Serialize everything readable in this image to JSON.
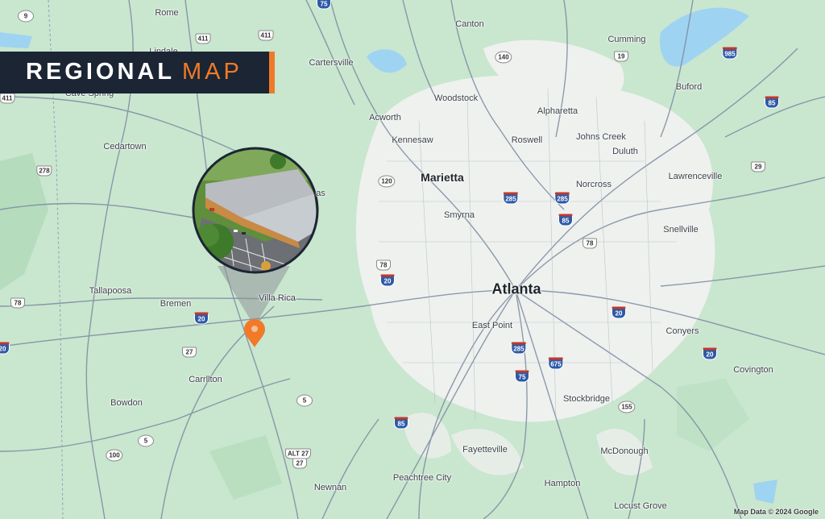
{
  "header": {
    "title_bold": "REGIONAL",
    "title_light": "MAP"
  },
  "colors": {
    "accent": "#f07a28",
    "banner_bg": "#1b2533",
    "land": "#c9e6cf",
    "urban": "#eef1ee",
    "water": "#9fd3f2",
    "road": "#7d8aa0"
  },
  "icons": {
    "marker": "map-pin-icon",
    "photo": "property-aerial-photo"
  },
  "attribution": "Map Data © 2024 Google",
  "cities": [
    {
      "id": "rome",
      "name": "Rome",
      "cls": ""
    },
    {
      "id": "lindale",
      "name": "Lindale",
      "cls": ""
    },
    {
      "id": "cave-spring",
      "name": "Cave Spring",
      "cls": ""
    },
    {
      "id": "cedartown",
      "name": "Cedartown",
      "cls": ""
    },
    {
      "id": "tallapoosa",
      "name": "Tallapoosa",
      "cls": ""
    },
    {
      "id": "bremen",
      "name": "Bremen",
      "cls": ""
    },
    {
      "id": "villa-rica",
      "name": "Villa Rica",
      "cls": ""
    },
    {
      "id": "carrollton",
      "name": "Carrllton",
      "cls": ""
    },
    {
      "id": "bowdon",
      "name": "Bowdon",
      "cls": ""
    },
    {
      "id": "newnan",
      "name": "Newnan",
      "cls": ""
    },
    {
      "id": "peachtree-city",
      "name": "Peachtree City",
      "cls": ""
    },
    {
      "id": "fayetteville",
      "name": "Fayetteville",
      "cls": ""
    },
    {
      "id": "hampton",
      "name": "Hampton",
      "cls": ""
    },
    {
      "id": "locust-grove",
      "name": "Locust Grove",
      "cls": ""
    },
    {
      "id": "mcdonough",
      "name": "McDonough",
      "cls": ""
    },
    {
      "id": "stockbridge",
      "name": "Stockbridge",
      "cls": ""
    },
    {
      "id": "covington",
      "name": "Covington",
      "cls": ""
    },
    {
      "id": "conyers",
      "name": "Conyers",
      "cls": ""
    },
    {
      "id": "snellville",
      "name": "Snellville",
      "cls": ""
    },
    {
      "id": "lawrenceville",
      "name": "Lawrenceville",
      "cls": ""
    },
    {
      "id": "duluth",
      "name": "Duluth",
      "cls": ""
    },
    {
      "id": "johns-creek",
      "name": "Johns Creek",
      "cls": ""
    },
    {
      "id": "norcross",
      "name": "Norcross",
      "cls": ""
    },
    {
      "id": "buford",
      "name": "Buford",
      "cls": ""
    },
    {
      "id": "cumming",
      "name": "Cumming",
      "cls": ""
    },
    {
      "id": "canton",
      "name": "Canton",
      "cls": ""
    },
    {
      "id": "cartersville",
      "name": "Cartersville",
      "cls": ""
    },
    {
      "id": "woodstock",
      "name": "Woodstock",
      "cls": ""
    },
    {
      "id": "acworth",
      "name": "Acworth",
      "cls": ""
    },
    {
      "id": "alpharetta",
      "name": "Alpharetta",
      "cls": ""
    },
    {
      "id": "roswell",
      "name": "Roswell",
      "cls": ""
    },
    {
      "id": "kennesaw",
      "name": "Kennesaw",
      "cls": ""
    },
    {
      "id": "marietta",
      "name": "Marietta",
      "cls": "major"
    },
    {
      "id": "smyrna",
      "name": "Smyrna",
      "cls": ""
    },
    {
      "id": "east-point",
      "name": "East Point",
      "cls": ""
    },
    {
      "id": "atlanta",
      "name": "Atlanta",
      "cls": "large"
    },
    {
      "id": "douglasville-partial",
      "name": "as",
      "cls": ""
    }
  ],
  "shields": [
    {
      "label": "9",
      "type": "state"
    },
    {
      "label": "411",
      "type": "us"
    },
    {
      "label": "411",
      "type": "us"
    },
    {
      "label": "411",
      "type": "us"
    },
    {
      "label": "75",
      "type": "interstate"
    },
    {
      "label": "140",
      "type": "state"
    },
    {
      "label": "19",
      "type": "us"
    },
    {
      "label": "985",
      "type": "interstate"
    },
    {
      "label": "85",
      "type": "interstate"
    },
    {
      "label": "29",
      "type": "us"
    },
    {
      "label": "278",
      "type": "us"
    },
    {
      "label": "120",
      "type": "state"
    },
    {
      "label": "285",
      "type": "interstate"
    },
    {
      "label": "285",
      "type": "interstate"
    },
    {
      "label": "85",
      "type": "interstate"
    },
    {
      "label": "78",
      "type": "us"
    },
    {
      "label": "78",
      "type": "us"
    },
    {
      "label": "20",
      "type": "interstate"
    },
    {
      "label": "78",
      "type": "us"
    },
    {
      "label": "20",
      "type": "interstate"
    },
    {
      "label": "20",
      "type": "interstate"
    },
    {
      "label": "20",
      "type": "interstate"
    },
    {
      "label": "20",
      "type": "interstate"
    },
    {
      "label": "27",
      "type": "us"
    },
    {
      "label": "285",
      "type": "interstate"
    },
    {
      "label": "675",
      "type": "interstate"
    },
    {
      "label": "75",
      "type": "interstate"
    },
    {
      "label": "155",
      "type": "state"
    },
    {
      "label": "5",
      "type": "state"
    },
    {
      "label": "5",
      "type": "state"
    },
    {
      "label": "85",
      "type": "interstate"
    },
    {
      "label": "100",
      "type": "state"
    },
    {
      "label": "ALT 27",
      "type": "us"
    },
    {
      "label": "27",
      "type": "us"
    }
  ]
}
